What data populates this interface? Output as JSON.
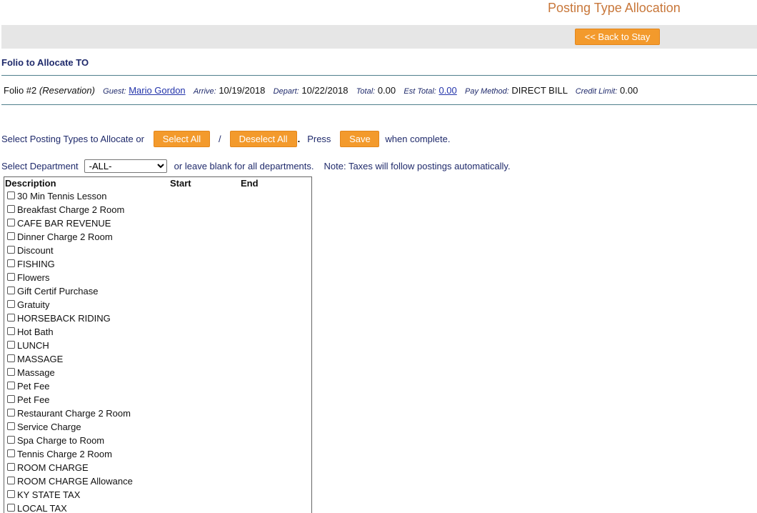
{
  "page": {
    "title": "Posting Type Allocation",
    "back_button": "<< Back to Stay"
  },
  "section_title": "Folio to Allocate TO",
  "folio": {
    "name": "Folio #2",
    "type": "(Reservation)",
    "guest_label": "Guest:",
    "guest": "Mario Gordon",
    "arrive_label": "Arrive:",
    "arrive": "10/19/2018",
    "depart_label": "Depart:",
    "depart": "10/22/2018",
    "total_label": "Total:",
    "total": "0.00",
    "est_total_label": "Est Total:",
    "est_total": "0.00",
    "pay_method_label": "Pay Method:",
    "pay_method": "DIRECT BILL",
    "credit_limit_label": "Credit Limit:",
    "credit_limit": "0.00"
  },
  "controls": {
    "select_prompt": "Select Posting Types to Allocate or",
    "select_all": "Select All",
    "slash": "/",
    "deselect_all": "Deselect All",
    "dot": ".",
    "press": "Press",
    "save": "Save",
    "complete": "when complete.",
    "dept_label": "Select Department",
    "dept_selected": "-ALL-",
    "dept_hint": "or leave blank for all departments.",
    "tax_note": "Note: Taxes will follow postings automatically."
  },
  "table": {
    "headers": {
      "description": "Description",
      "start": "Start",
      "end": "End"
    },
    "rows": [
      "30 Min Tennis Lesson",
      "Breakfast Charge 2 Room",
      "CAFE BAR REVENUE",
      "Dinner Charge 2 Room",
      "Discount",
      "FISHING",
      "Flowers",
      "Gift Certif Purchase",
      "Gratuity",
      "HORSEBACK RIDING",
      "Hot Bath",
      "LUNCH",
      "MASSAGE",
      "Massage",
      "Pet Fee",
      "Pet Fee",
      "Restaurant Charge 2 Room",
      "Service Charge",
      "Spa Charge to Room",
      "Tennis Charge 2 Room",
      "ROOM CHARGE",
      "ROOM CHARGE Allowance",
      "KY STATE TAX",
      "LOCAL TAX"
    ]
  },
  "colors": {
    "accent_orange": "#f39a2c",
    "title_orange": "#c8773a",
    "navy_text": "#1f2a6b",
    "divider": "#4f7f8c",
    "bar_gray": "#e6e6e6"
  }
}
